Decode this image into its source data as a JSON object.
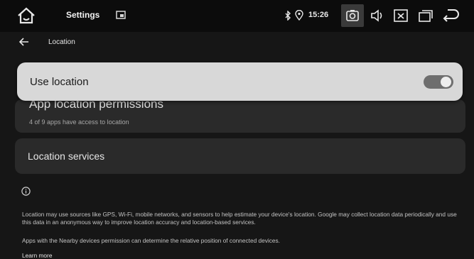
{
  "status_bar": {
    "app_name": "Settings",
    "time": "15:26",
    "icons": [
      "home-icon",
      "app-window-icon",
      "bluetooth-icon",
      "location-pin-icon",
      "screenshot-icon",
      "volume-icon",
      "screen-off-icon",
      "recents-icon",
      "back-icon"
    ]
  },
  "top_bar": {
    "title": "Location",
    "back_icon": "arrow-left-icon"
  },
  "use_location": {
    "label": "Use location",
    "enabled": true
  },
  "app_permissions": {
    "title": "App location permissions",
    "summary": "4 of 9 apps have access to location"
  },
  "location_services": {
    "title": "Location services"
  },
  "footer": {
    "info_icon": "info-icon",
    "paragraph1": "Location may use sources like GPS, Wi-Fi, mobile networks, and sensors to help estimate your device's location. Google may collect location data periodically and use this data in an anonymous way to improve location accuracy and location-based services.",
    "paragraph2": "Apps with the Nearby devices permission can determine the relative position of connected devices.",
    "learn_more": "Learn more"
  },
  "colors": {
    "background": "#161616",
    "card": "#2a2a2a",
    "highlight_card": "#d8d8d8",
    "toggle_track": "#6e6e6e"
  }
}
